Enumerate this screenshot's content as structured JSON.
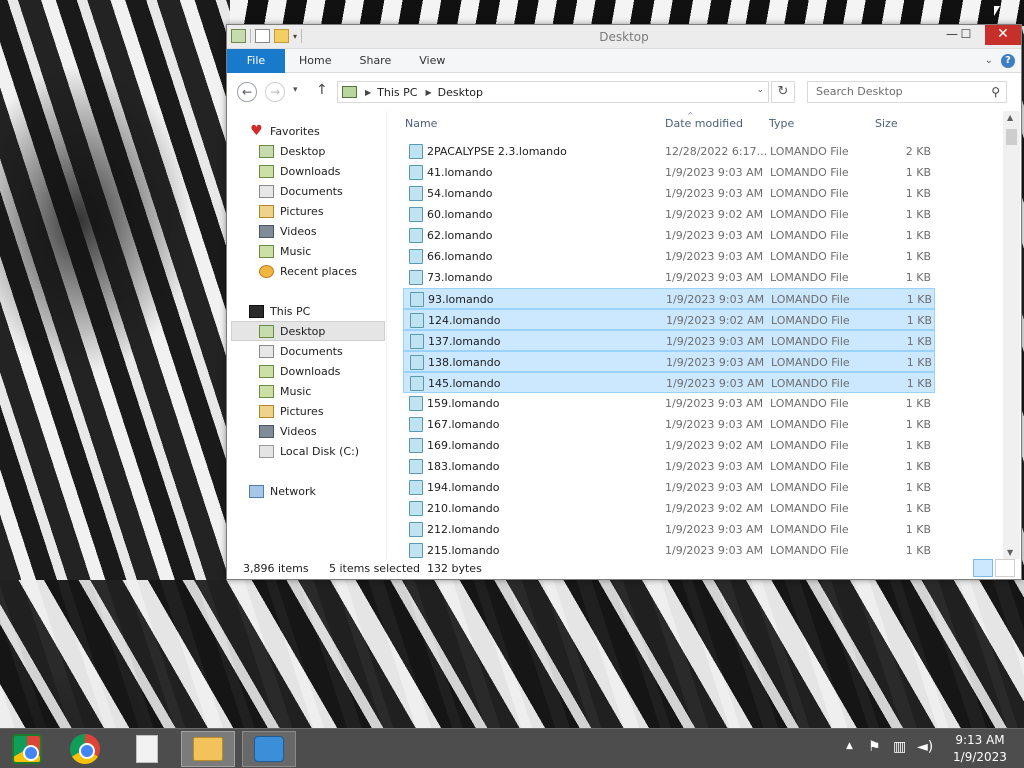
{
  "window": {
    "title": "Desktop",
    "controls": {
      "minimize": "—",
      "maximize": "☐",
      "close": "✕"
    }
  },
  "ribbon": {
    "tabs": [
      "File",
      "Home",
      "Share",
      "View"
    ]
  },
  "address": {
    "path": [
      "This PC",
      "Desktop"
    ],
    "search_placeholder": "Search Desktop"
  },
  "navpane": {
    "favorites": {
      "label": "Favorites",
      "items": [
        "Desktop",
        "Downloads",
        "Documents",
        "Pictures",
        "Videos",
        "Music",
        "Recent places"
      ]
    },
    "this_pc": {
      "label": "This PC",
      "items": [
        "Desktop",
        "Documents",
        "Downloads",
        "Music",
        "Pictures",
        "Videos",
        "Local Disk (C:)"
      ]
    },
    "network": {
      "label": "Network"
    },
    "selected": "This PC > Desktop"
  },
  "columns": {
    "name": "Name",
    "date": "Date modified",
    "type": "Type",
    "size": "Size"
  },
  "files": [
    {
      "name": "2PACALYPSE 2.3.lomando",
      "date": "12/28/2022 6:17...",
      "type": "LOMANDO File",
      "size": "2 KB",
      "selected": false
    },
    {
      "name": "41.lomando",
      "date": "1/9/2023 9:03 AM",
      "type": "LOMANDO File",
      "size": "1 KB",
      "selected": false
    },
    {
      "name": "54.lomando",
      "date": "1/9/2023 9:03 AM",
      "type": "LOMANDO File",
      "size": "1 KB",
      "selected": false
    },
    {
      "name": "60.lomando",
      "date": "1/9/2023 9:02 AM",
      "type": "LOMANDO File",
      "size": "1 KB",
      "selected": false
    },
    {
      "name": "62.lomando",
      "date": "1/9/2023 9:03 AM",
      "type": "LOMANDO File",
      "size": "1 KB",
      "selected": false
    },
    {
      "name": "66.lomando",
      "date": "1/9/2023 9:03 AM",
      "type": "LOMANDO File",
      "size": "1 KB",
      "selected": false
    },
    {
      "name": "73.lomando",
      "date": "1/9/2023 9:03 AM",
      "type": "LOMANDO File",
      "size": "1 KB",
      "selected": false
    },
    {
      "name": "93.lomando",
      "date": "1/9/2023 9:03 AM",
      "type": "LOMANDO File",
      "size": "1 KB",
      "selected": true
    },
    {
      "name": "124.lomando",
      "date": "1/9/2023 9:02 AM",
      "type": "LOMANDO File",
      "size": "1 KB",
      "selected": true
    },
    {
      "name": "137.lomando",
      "date": "1/9/2023 9:03 AM",
      "type": "LOMANDO File",
      "size": "1 KB",
      "selected": true
    },
    {
      "name": "138.lomando",
      "date": "1/9/2023 9:03 AM",
      "type": "LOMANDO File",
      "size": "1 KB",
      "selected": true
    },
    {
      "name": "145.lomando",
      "date": "1/9/2023 9:03 AM",
      "type": "LOMANDO File",
      "size": "1 KB",
      "selected": true
    },
    {
      "name": "159.lomando",
      "date": "1/9/2023 9:03 AM",
      "type": "LOMANDO File",
      "size": "1 KB",
      "selected": false
    },
    {
      "name": "167.lomando",
      "date": "1/9/2023 9:03 AM",
      "type": "LOMANDO File",
      "size": "1 KB",
      "selected": false
    },
    {
      "name": "169.lomando",
      "date": "1/9/2023 9:02 AM",
      "type": "LOMANDO File",
      "size": "1 KB",
      "selected": false
    },
    {
      "name": "183.lomando",
      "date": "1/9/2023 9:03 AM",
      "type": "LOMANDO File",
      "size": "1 KB",
      "selected": false
    },
    {
      "name": "194.lomando",
      "date": "1/9/2023 9:03 AM",
      "type": "LOMANDO File",
      "size": "1 KB",
      "selected": false
    },
    {
      "name": "210.lomando",
      "date": "1/9/2023 9:02 AM",
      "type": "LOMANDO File",
      "size": "1 KB",
      "selected": false
    },
    {
      "name": "212.lomando",
      "date": "1/9/2023 9:03 AM",
      "type": "LOMANDO File",
      "size": "1 KB",
      "selected": false
    },
    {
      "name": "215.lomando",
      "date": "1/9/2023 9:03 AM",
      "type": "LOMANDO File",
      "size": "1 KB",
      "selected": false
    }
  ],
  "status": {
    "item_count": "3,896 items",
    "selected_count": "5 items selected",
    "selected_size": "132 bytes"
  },
  "taskbar": {
    "apps": [
      "chrome-app-icon",
      "chrome-icon",
      "blank-document-icon",
      "file-explorer-icon",
      "people-app-icon"
    ],
    "active_app": "file-explorer-icon"
  },
  "tray": {
    "icons": [
      "show-hidden-icons-arrow",
      "action-center-flag-icon",
      "network-icon",
      "volume-icon"
    ],
    "time": "9:13 AM",
    "date": "1/9/2023"
  },
  "colors": {
    "file_tab": "#1979ca",
    "selection_fill": "#cce8ff",
    "selection_border": "#99d1ff",
    "close_button": "#c7302a",
    "taskbar": "#4d4d4d"
  }
}
